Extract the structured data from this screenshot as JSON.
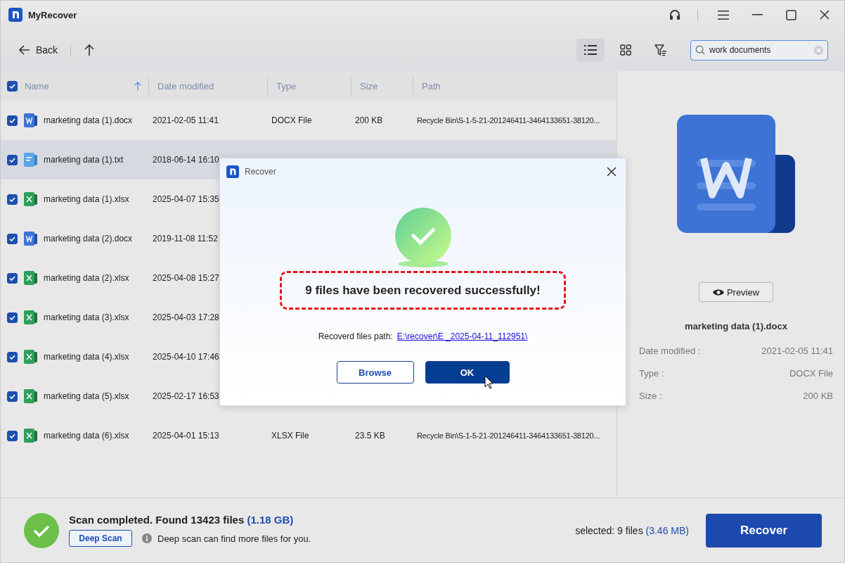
{
  "app": {
    "title": "MyRecover"
  },
  "toolbar": {
    "back": "Back",
    "view_modes": [
      {
        "kind": "list",
        "selected": true
      },
      {
        "kind": "grid",
        "selected": false
      }
    ],
    "search": {
      "value": "work documents"
    }
  },
  "table": {
    "columns": [
      "Name",
      "Date modified",
      "Type",
      "Size",
      "Path"
    ],
    "all_checked": true,
    "rows": [
      {
        "kind": "docx",
        "checked": true,
        "selected": false,
        "name": "marketing data (1).docx",
        "date": "2021-02-05 11:41",
        "type": "DOCX File",
        "size": "200 KB",
        "path": "Recycle Bin\\S-1-5-21-201246411-3464133651-38120..."
      },
      {
        "kind": "txt",
        "checked": true,
        "selected": true,
        "name": "marketing data (1).txt",
        "date": "2018-06-14 16:10"
      },
      {
        "kind": "xlsx",
        "checked": true,
        "selected": false,
        "name": "marketing data (1).xlsx",
        "date": "2025-04-07 15:35"
      },
      {
        "kind": "docx",
        "checked": true,
        "selected": false,
        "name": "marketing data (2).docx",
        "date": "2019-11-08 11:52"
      },
      {
        "kind": "xlsx",
        "checked": true,
        "selected": false,
        "name": "marketing data (2).xlsx",
        "date": "2025-04-08 15:27"
      },
      {
        "kind": "xlsx",
        "checked": true,
        "selected": false,
        "name": "marketing data (3).xlsx",
        "date": "2025-04-03 17:28"
      },
      {
        "kind": "xlsx",
        "checked": true,
        "selected": false,
        "name": "marketing data (4).xlsx",
        "date": "2025-04-10 17:46"
      },
      {
        "kind": "xlsx",
        "checked": true,
        "selected": false,
        "name": "marketing data (5).xlsx",
        "date": "2025-02-17 16:53"
      },
      {
        "kind": "xlsx",
        "checked": true,
        "selected": false,
        "name": "marketing data (6).xlsx",
        "date": "2025-04-01 15:13",
        "type": "XLSX File",
        "size": "23.5 KB",
        "path": "Recycle Bin\\S-1-5-21-201246411-3464133651-38120..."
      }
    ]
  },
  "preview": {
    "button": "Preview",
    "file_name": "marketing data (1).docx",
    "details": [
      {
        "label": "Date modified :",
        "value": "2021-02-05 11:41"
      },
      {
        "label": "Type :",
        "value": "DOCX File"
      },
      {
        "label": "Size :",
        "value": "200 KB"
      }
    ]
  },
  "status": {
    "text": "Scan completed. Found 13423 files",
    "size": "(1.18 GB)",
    "deep_scan": "Deep Scan",
    "hint": "Deep scan can find more files for you.",
    "selected": "selected: 9 files",
    "selected_size": "(3.46 MB)",
    "recover": "Recover"
  },
  "dialog": {
    "title": "Recover",
    "message": "9 files have been recovered successfully!",
    "path_label": "Recoverd files path:",
    "path": "E:\\recover\\E _2025-04-11_112951\\",
    "buttons": [
      "Browse",
      "OK"
    ]
  }
}
